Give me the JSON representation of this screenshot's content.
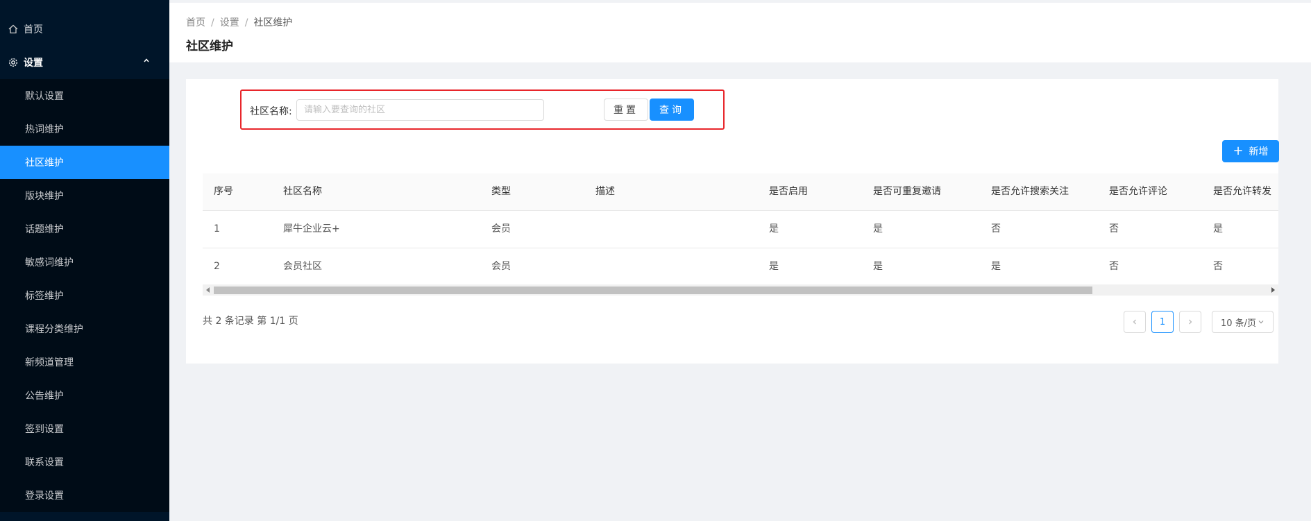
{
  "sidebar": {
    "home": "首页",
    "group": "设置",
    "items": [
      {
        "label": "默认设置",
        "active": false
      },
      {
        "label": "热词维护",
        "active": false
      },
      {
        "label": "社区维护",
        "active": true
      },
      {
        "label": "版块维护",
        "active": false
      },
      {
        "label": "话题维护",
        "active": false
      },
      {
        "label": "敏感词维护",
        "active": false
      },
      {
        "label": "标签维护",
        "active": false
      },
      {
        "label": "课程分类维护",
        "active": false
      },
      {
        "label": "新频道管理",
        "active": false
      },
      {
        "label": "公告维护",
        "active": false
      },
      {
        "label": "签到设置",
        "active": false
      },
      {
        "label": "联系设置",
        "active": false
      },
      {
        "label": "登录设置",
        "active": false
      }
    ]
  },
  "breadcrumb": [
    "首页",
    "设置",
    "社区维护"
  ],
  "page_title": "社区维护",
  "search": {
    "label": "社区名称:",
    "placeholder": "请输入要查询的社区",
    "value": "",
    "reset_label": "重置",
    "query_label": "查询"
  },
  "add_label": "新增",
  "table": {
    "headers": [
      "序号",
      "社区名称",
      "类型",
      "描述",
      "是否启用",
      "是否可重复邀请",
      "是否允许搜索关注",
      "是否允许评论",
      "是否允许转发"
    ],
    "rows": [
      [
        "1",
        "犀牛企业云+",
        "会员",
        "",
        "是",
        "是",
        "否",
        "否",
        "是"
      ],
      [
        "2",
        "会员社区",
        "会员",
        "",
        "是",
        "是",
        "是",
        "否",
        "否"
      ]
    ]
  },
  "pagination": {
    "summary": "共 2 条记录 第 1/1 页",
    "current_page": "1",
    "page_size": "10 条/页"
  },
  "colors": {
    "sidebar_bg": "#001529",
    "accent": "#1890ff",
    "highlight_border": "#e8262b"
  }
}
